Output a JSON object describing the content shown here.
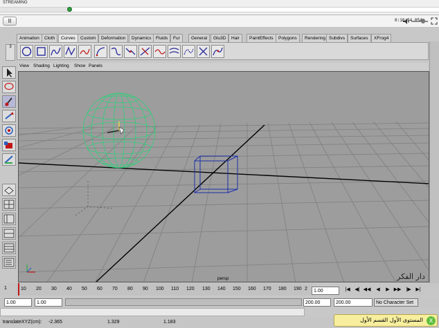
{
  "player": {
    "stream_label": "STREAMING",
    "progress": 0.16,
    "pause_label": "II",
    "timecode": "0:10:54.054"
  },
  "maya": {
    "shelf_tabs": [
      "Animation",
      "Cloth",
      "Curves",
      "Custom",
      "Deformation",
      "Dynamics",
      "Fluids",
      "Fur",
      "General",
      "Glu3D",
      "Hair",
      "PaintEffects",
      "Polygons",
      "Rendering",
      "Subdivs",
      "Surfaces",
      "XFrog4"
    ],
    "active_shelf_tab": "Curves",
    "shelf_side_label": "3",
    "panel_menu": [
      "View",
      "Shading",
      "Lighting",
      "Show",
      "Panels"
    ],
    "camera_label": "persp",
    "watermark": "دار الفكر",
    "timeline_ticks": [
      "10",
      "20",
      "30",
      "40",
      "50",
      "60",
      "70",
      "80",
      "90",
      "100",
      "110",
      "120",
      "130",
      "140",
      "150",
      "160",
      "170",
      "180",
      "190"
    ],
    "timeline_left": "1",
    "timeline_end": "2",
    "current_frame": "1.00",
    "range_start": "1.00",
    "range_start2": "1.00",
    "range_end": "200.00",
    "range_end2": "200.00",
    "char_set": "No Character Set",
    "help_line": {
      "label": "translateXYZ(cm):",
      "x": "-2.365",
      "y": "1.329",
      "z": "1.183"
    }
  },
  "lesson": {
    "text": "المستوى الأول القسم الأول",
    "icon": "X"
  }
}
